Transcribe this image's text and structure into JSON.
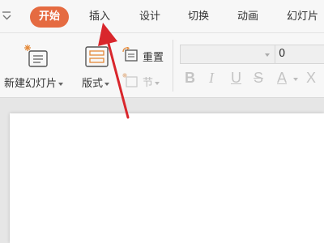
{
  "tabs": [
    {
      "label": "开始",
      "active": true
    },
    {
      "label": "插入"
    },
    {
      "label": "设计"
    },
    {
      "label": "切换"
    },
    {
      "label": "动画"
    },
    {
      "label": "幻灯片"
    }
  ],
  "ribbon": {
    "new_slide_label": "新建幻灯片",
    "layout_label": "版式",
    "reset_label": "重置",
    "section_label": "节",
    "font_name_value": "",
    "font_size_value": "0",
    "bold_glyph": "B",
    "italic_glyph": "I",
    "underline_glyph": "U",
    "strike_glyph": "S",
    "font_color_glyph": "A",
    "clear_glyph": "X"
  },
  "colors": {
    "active_tab": "#e56b41",
    "annotation_arrow": "#d9262c",
    "icon_accent": "#e58a3a"
  },
  "icons": [
    "dropdown-arrow-icon",
    "new-slide-icon",
    "layout-icon",
    "reset-icon",
    "section-icon",
    "annotation-arrow"
  ]
}
